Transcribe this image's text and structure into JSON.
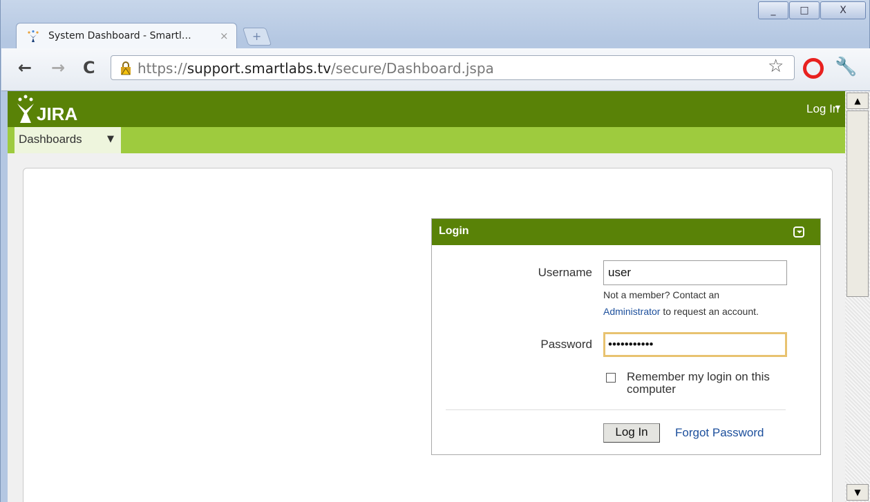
{
  "browser": {
    "tab_title": "System Dashboard - Smartl…",
    "tab_close": "×",
    "new_tab": "+",
    "url_scheme": "https://",
    "url_host": "support.smartlabs.tv",
    "url_path": "/secure/Dashboard.jspa",
    "window_buttons": [
      "_",
      "□",
      "X"
    ]
  },
  "header": {
    "logo_text": "JIRA",
    "login_link": "Log In",
    "nav_dashboards": "Dashboards"
  },
  "login_gadget": {
    "title": "Login",
    "username_label": "Username",
    "username_value": "user",
    "member_hint": "Not a member? Contact an",
    "admin_link": "Administrator",
    "request_text": "to request an account.",
    "password_label": "Password",
    "password_value": "•••••••••••",
    "remember_label": "Remember my login on this computer",
    "login_button": "Log In",
    "forgot_link": "Forgot Password"
  },
  "colors": {
    "jira_green": "#598207",
    "nav_green": "#9ecb3e",
    "focus_border": "#e8c270"
  }
}
